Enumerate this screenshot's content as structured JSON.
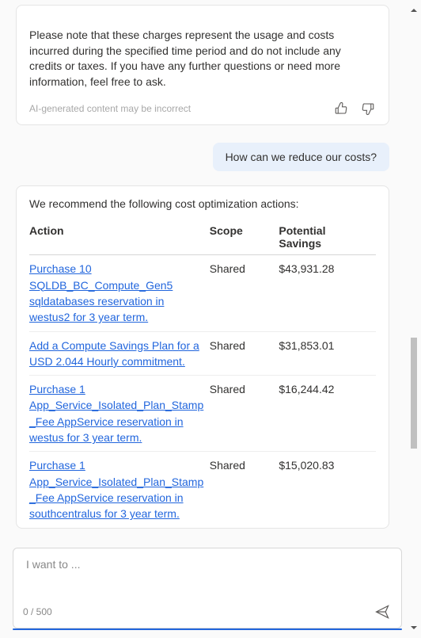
{
  "note": {
    "text": "Please note that these charges represent the usage and costs incurred during the specified time period and do not include any credits or taxes. If you have any further questions or need more information, feel free to ask.",
    "ai_label": "AI-generated content may be incorrect"
  },
  "user_message": "How can we reduce our costs?",
  "recommend": {
    "intro": "We recommend the following cost optimization actions:",
    "headers": {
      "action": "Action",
      "scope": "Scope",
      "savings": "Potential Savings"
    },
    "rows": [
      {
        "action": "Purchase 10 SQLDB_BC_Compute_Gen5 sqldatabases reservation in westus2 for 3 year term.",
        "scope": "Shared",
        "savings": "$43,931.28"
      },
      {
        "action": "Add a Compute Savings Plan for a USD 2.044 Hourly commitment.",
        "scope": "Shared",
        "savings": "$31,853.01"
      },
      {
        "action": "Purchase 1 App_Service_Isolated_Plan_Stamp_Fee AppService reservation in westus for 3 year term.",
        "scope": "Shared",
        "savings": "$16,244.42"
      },
      {
        "action": "Purchase 1 App_Service_Isolated_Plan_Stamp_Fee AppService reservation in southcentralus for 3 year term.",
        "scope": "Shared",
        "savings": "$15,020.83"
      }
    ]
  },
  "input": {
    "placeholder": "I want to ...",
    "counter": "0 / 500"
  }
}
